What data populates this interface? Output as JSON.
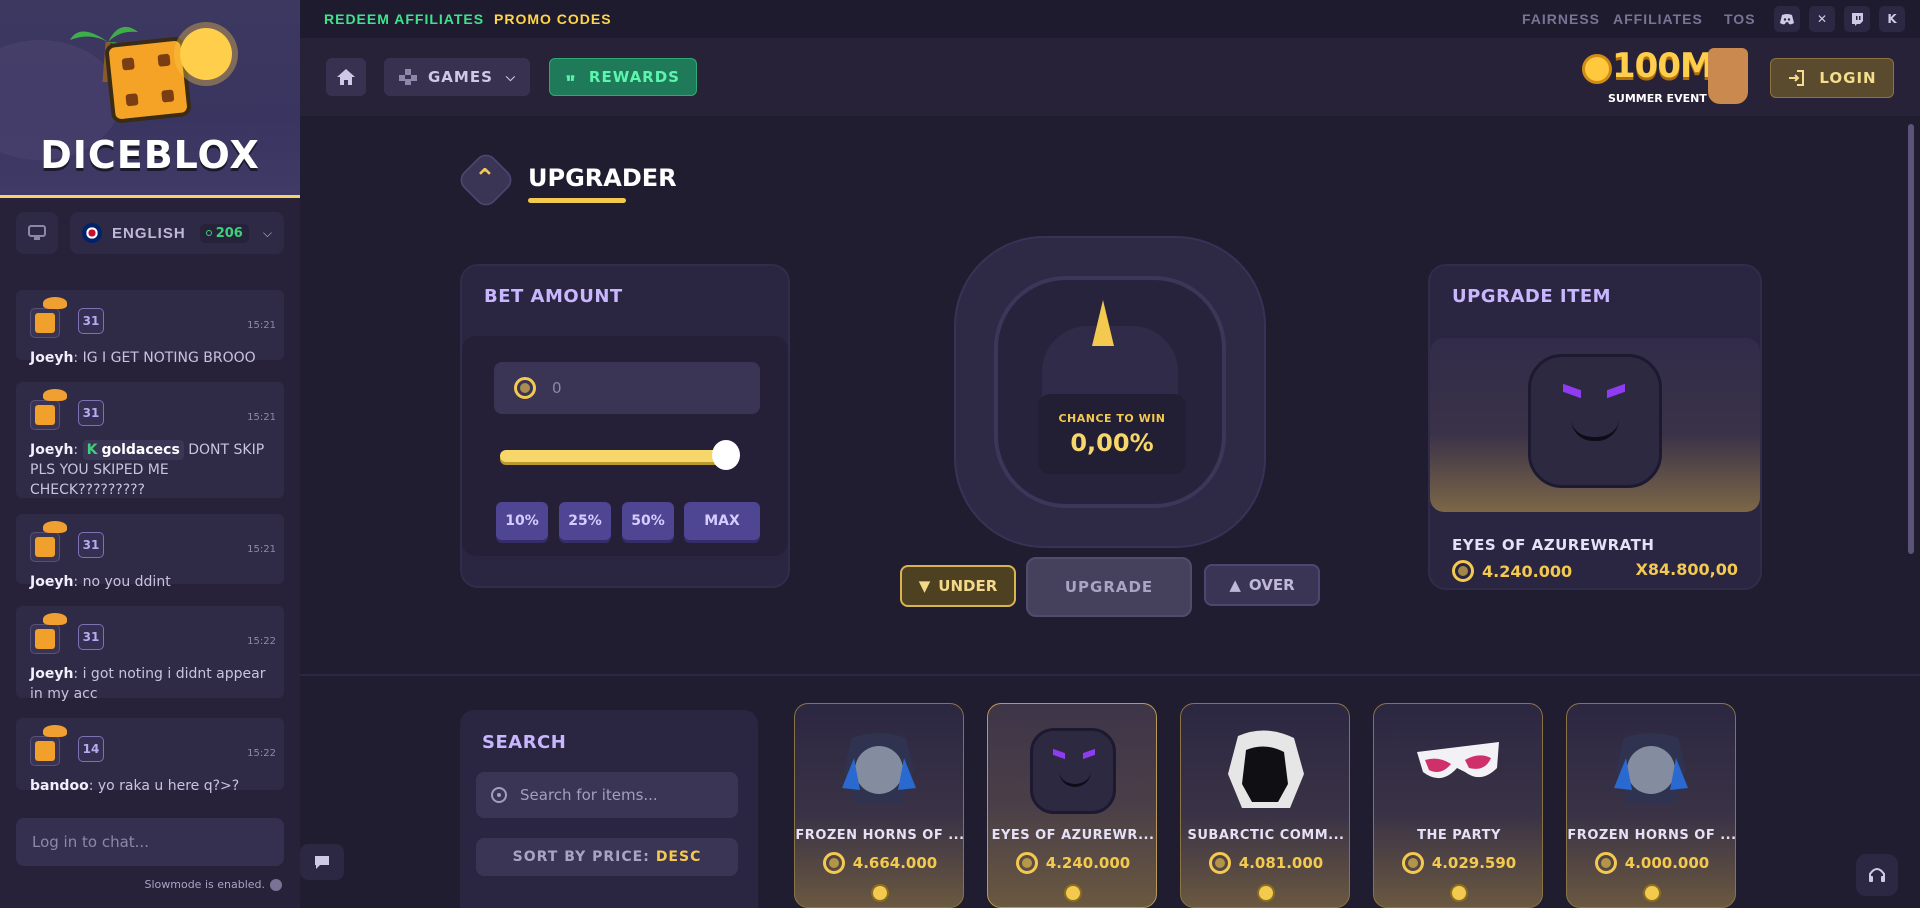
{
  "brand": {
    "name": "DICEBLOX"
  },
  "topbar": {
    "redeem": "REDEEM AFFILIATES",
    "promo": "PROMO CODES",
    "fairness": "FAIRNESS",
    "affiliates": "AFFILIATES",
    "tos": "TOS",
    "social": [
      "discord-icon",
      "x-icon",
      "twitch-icon",
      "kick-icon"
    ]
  },
  "nav": {
    "games": "GAMES",
    "rewards": "REWARDS",
    "event_big": "100M",
    "event_small": "SUMMER EVENT",
    "login": "LOGIN"
  },
  "sidebar": {
    "language": "ENGLISH",
    "online_count": "206",
    "messages": [
      {
        "level": "31",
        "time": "15:21",
        "user": "Joeyh",
        "text": ": IG I GET NOTING BROOO"
      },
      {
        "level": "31",
        "time": "15:21",
        "user": "Joeyh",
        "mention": "goldacecs",
        "text": " DONT SKIP PLS YOU SKIPED ME CHECK?????????"
      },
      {
        "level": "31",
        "time": "15:21",
        "user": "Joeyh",
        "text": ": no you ddint"
      },
      {
        "level": "31",
        "time": "15:22",
        "user": "Joeyh",
        "text": ": i got noting i didnt appear in my acc"
      },
      {
        "level": "14",
        "time": "15:22",
        "user": "bandoo",
        "text": ": yo raka u here q?>?"
      }
    ],
    "chat_placeholder": "Log in to chat...",
    "slowmode": "Slowmode is enabled."
  },
  "upgrader": {
    "title": "UPGRADER",
    "bet_title": "BET AMOUNT",
    "bet_value": "0",
    "slider_fraction": 0.95,
    "pct_buttons": [
      "10%",
      "25%",
      "50%",
      "MAX"
    ],
    "chance_label": "CHANCE TO WIN",
    "chance_value": "0,00%",
    "under": "UNDER",
    "upgrade": "UPGRADE",
    "over": "OVER",
    "item_title": "UPGRADE ITEM",
    "item_name": "EYES OF AZUREWRATH",
    "item_price": "4.240.000",
    "item_mult": "X84.800,00"
  },
  "search": {
    "title": "SEARCH",
    "placeholder": "Search for items...",
    "sort_label": "SORT BY PRICE:",
    "sort_value": "DESC"
  },
  "items": [
    {
      "name": "FROZEN HORNS OF ...",
      "price": "4.664.000",
      "selected": false
    },
    {
      "name": "EYES OF AZUREWR...",
      "price": "4.240.000",
      "selected": true
    },
    {
      "name": "SUBARCTIC COMM...",
      "price": "4.081.000",
      "selected": false
    },
    {
      "name": "THE PARTY",
      "price": "4.029.590",
      "selected": false
    },
    {
      "name": "FROZEN HORNS OF ...",
      "price": "4.000.000",
      "selected": false
    }
  ],
  "colors": {
    "accent_gold": "#f3c94f",
    "accent_green": "#3ee48d",
    "accent_purple": "#c8b6ff"
  }
}
